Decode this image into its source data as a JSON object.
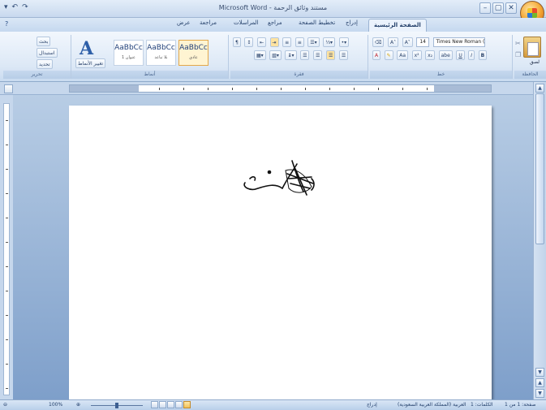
{
  "titlebar": {
    "title": "Microsoft Word - مستند وثائق الرحمة",
    "qat": [
      "▾",
      "↶",
      "↷"
    ],
    "window_buttons": [
      "–",
      "▢",
      "✕"
    ]
  },
  "tabs": [
    {
      "label": "الصفحة الرئيسية",
      "active": true
    },
    {
      "label": "إدراج"
    },
    {
      "label": "تخطيط الصفحة"
    },
    {
      "label": "مراجع"
    },
    {
      "label": "المراسلات"
    },
    {
      "label": "مراجعة"
    },
    {
      "label": "عرض"
    }
  ],
  "help_label": "?",
  "ribbon": {
    "editing": {
      "find": "بحث",
      "replace": "استبدال",
      "select": "تحديد",
      "label": "تحرير"
    },
    "styles": {
      "change_styles": "تغيير الأنماط",
      "label": "أنماط",
      "boxes": [
        {
          "sample": "AaBbCc",
          "name": "عنوان 1"
        },
        {
          "sample": "AaBbCc",
          "name": "بلا تباعد"
        },
        {
          "sample": "AaBbCc",
          "name": "عادي",
          "selected": true
        }
      ]
    },
    "paragraph": {
      "label": "فقرة"
    },
    "font": {
      "label": "خط",
      "name_value": "Times New Roman (عربي)",
      "size_value": "14"
    },
    "clipboard": {
      "label": "الحافظة",
      "paste": "لصق"
    }
  },
  "status": {
    "page": "صفحة: 1 من 1",
    "words": "الكلمات: 1",
    "language": "العربية (المملكة العربية السعودية)",
    "mode": "إدراج",
    "zoom": "100%"
  },
  "colors": {
    "accent": "#2e5fa8",
    "ribbon": "#dce8f6",
    "workspace": "#8eabd2",
    "status": "#c6d7ec"
  }
}
